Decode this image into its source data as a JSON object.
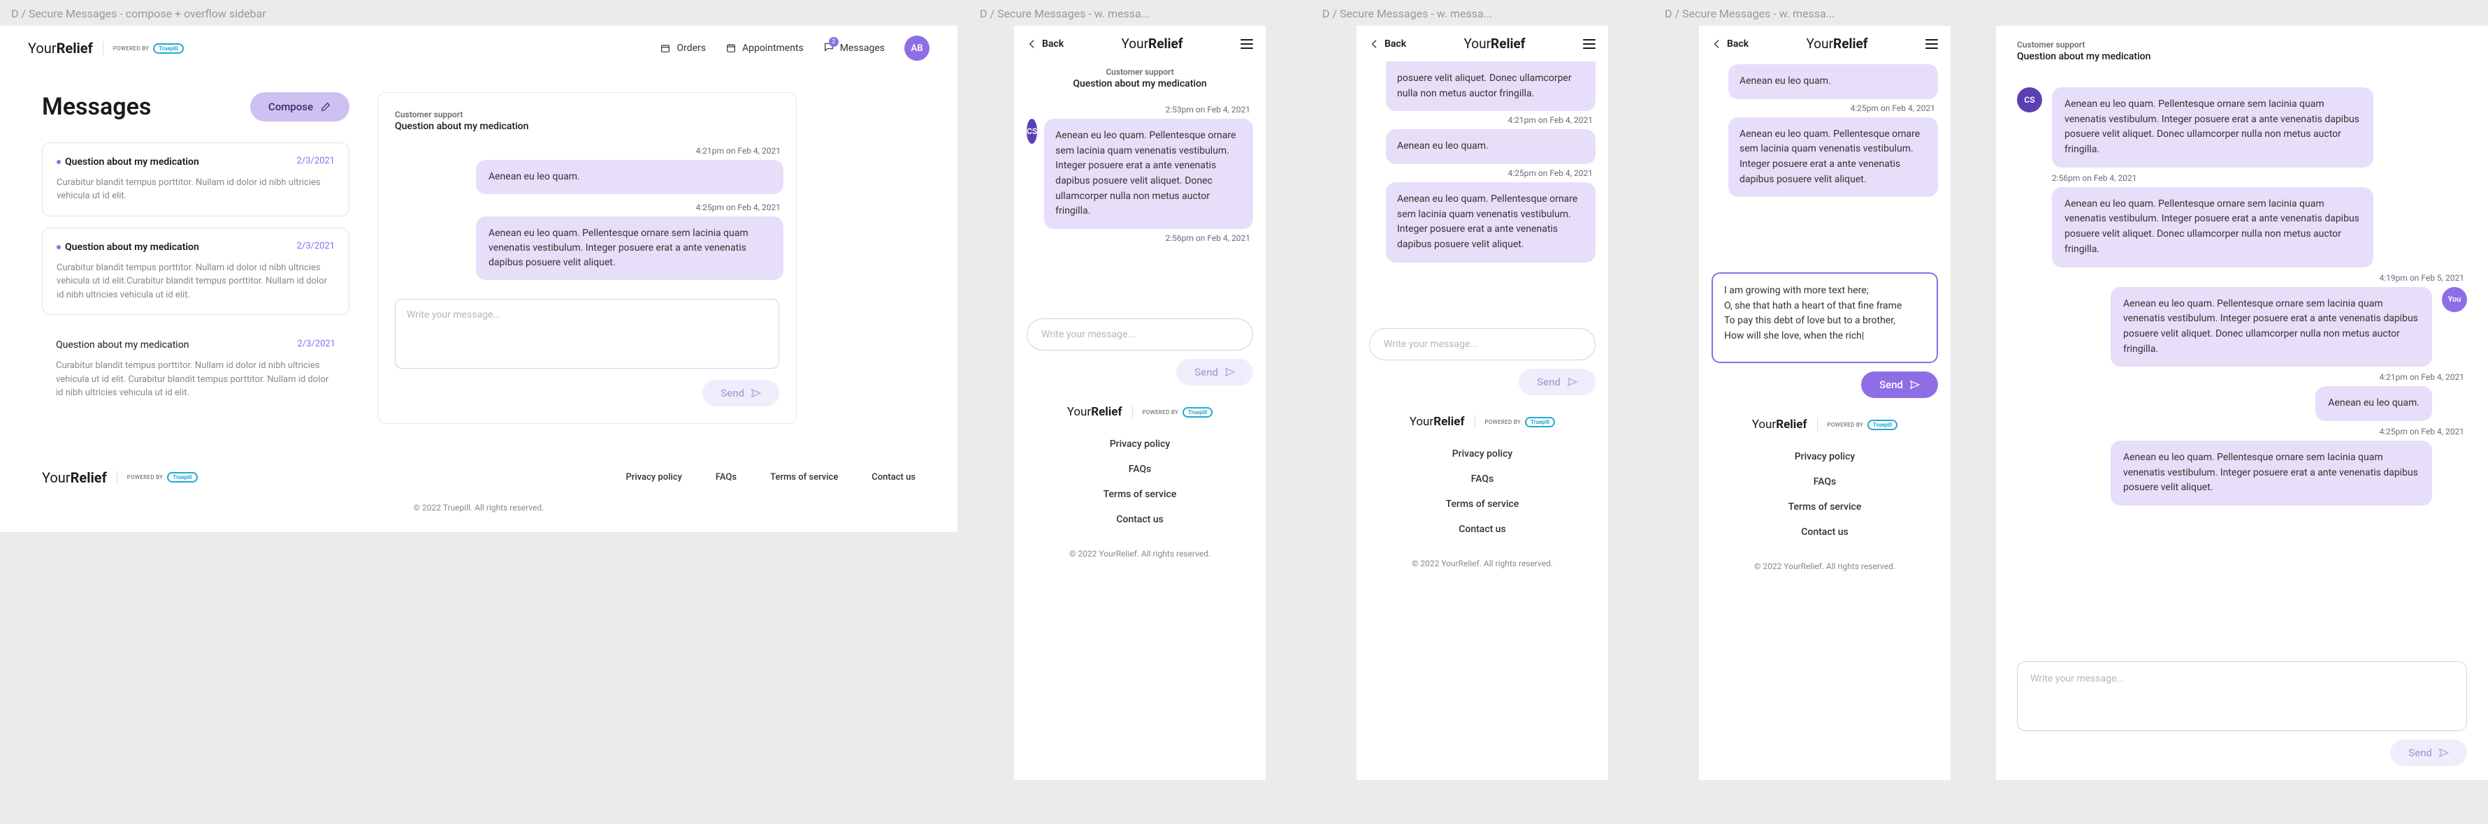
{
  "frame_labels": {
    "desktop": "D / Secure Messages - compose + overflow sidebar",
    "mobile1": "D / Secure Messages - w. messa...",
    "mobile2": "D / Secure Messages - w. messa...",
    "mobile3": "D / Secure Messages - w. messa..."
  },
  "brand": {
    "primary": "YourRelief",
    "primary_light_part": "Your",
    "primary_bold_part": "Relief",
    "powered_label": "POWERED BY",
    "truepill": "Truepill"
  },
  "nav": {
    "orders": "Orders",
    "appointments": "Appointments",
    "messages": "Messages",
    "messages_badge": "2",
    "avatar_initials": "AB"
  },
  "page": {
    "title": "Messages",
    "compose": "Compose"
  },
  "threads": [
    {
      "subject": "Question about my medication",
      "date": "2/3/2021",
      "preview": "Curabitur blandit tempus porttitor. Nullam id dolor id nibh ultricies vehicula ut id elit."
    },
    {
      "subject": "Question about my medication",
      "date": "2/3/2021",
      "preview": "Curabitur blandit tempus porttitor. Nullam id dolor id nibh ultricies vehicula ut id elit.Curabitur blandit tempus porttitor. Nullam id dolor id nibh ultricies vehicula ut id elit."
    },
    {
      "subject": "Question about my medication",
      "date": "2/3/2021",
      "preview": "Curabitur blandit tempus porttitor. Nullam id dolor id nibh ultricies vehicula ut id elit. Curabitur blandit tempus porttitor. Nullam id dolor id nibh ultricies vehicula ut id elit."
    }
  ],
  "conv": {
    "support_label": "Customer support",
    "subject": "Question about my medication",
    "cs_initials": "CS",
    "you_label": "You",
    "msg_short": "Aenean eu leo quam.",
    "msg_med": "Aenean eu leo quam. Pellentesque ornare sem lacinia quam venenatis vestibulum. Integer posuere erat a ante venenatis dapibus posuere velit aliquet.",
    "msg_long": "Aenean eu leo quam. Pellentesque ornare sem lacinia quam venenatis vestibulum. Integer posuere erat a ante venenatis dapibus posuere velit aliquet. Donec ullamcorper nulla non metus auctor fringilla.",
    "msg_cut": "posuere velit aliquet. Donec ullamcorper nulla non metus auctor fringilla.",
    "draft_text": "I am growing with more text here;\nO, she that hath a heart of that fine frame\nTo pay this debt of love but to a brother,\nHow will she love, when the rich|",
    "times": {
      "t253": "2:53pm on Feb 4, 2021",
      "t256": "2:56pm on Feb 4, 2021",
      "t419_feb5": "4:19pm on Feb 5, 2021",
      "t421": "4:21pm on Feb 4, 2021",
      "t425": "4:25pm on Feb 4, 2021"
    },
    "placeholder": "Write your message...",
    "send": "Send"
  },
  "back": "Back",
  "footer": {
    "privacy": "Privacy policy",
    "faqs": "FAQs",
    "terms": "Terms of service",
    "contact": "Contact us",
    "copyright_desktop": "© 2022 Truepill. All rights reserved.",
    "copyright_mobile": "© 2022 YourRelief. All rights reserved."
  }
}
